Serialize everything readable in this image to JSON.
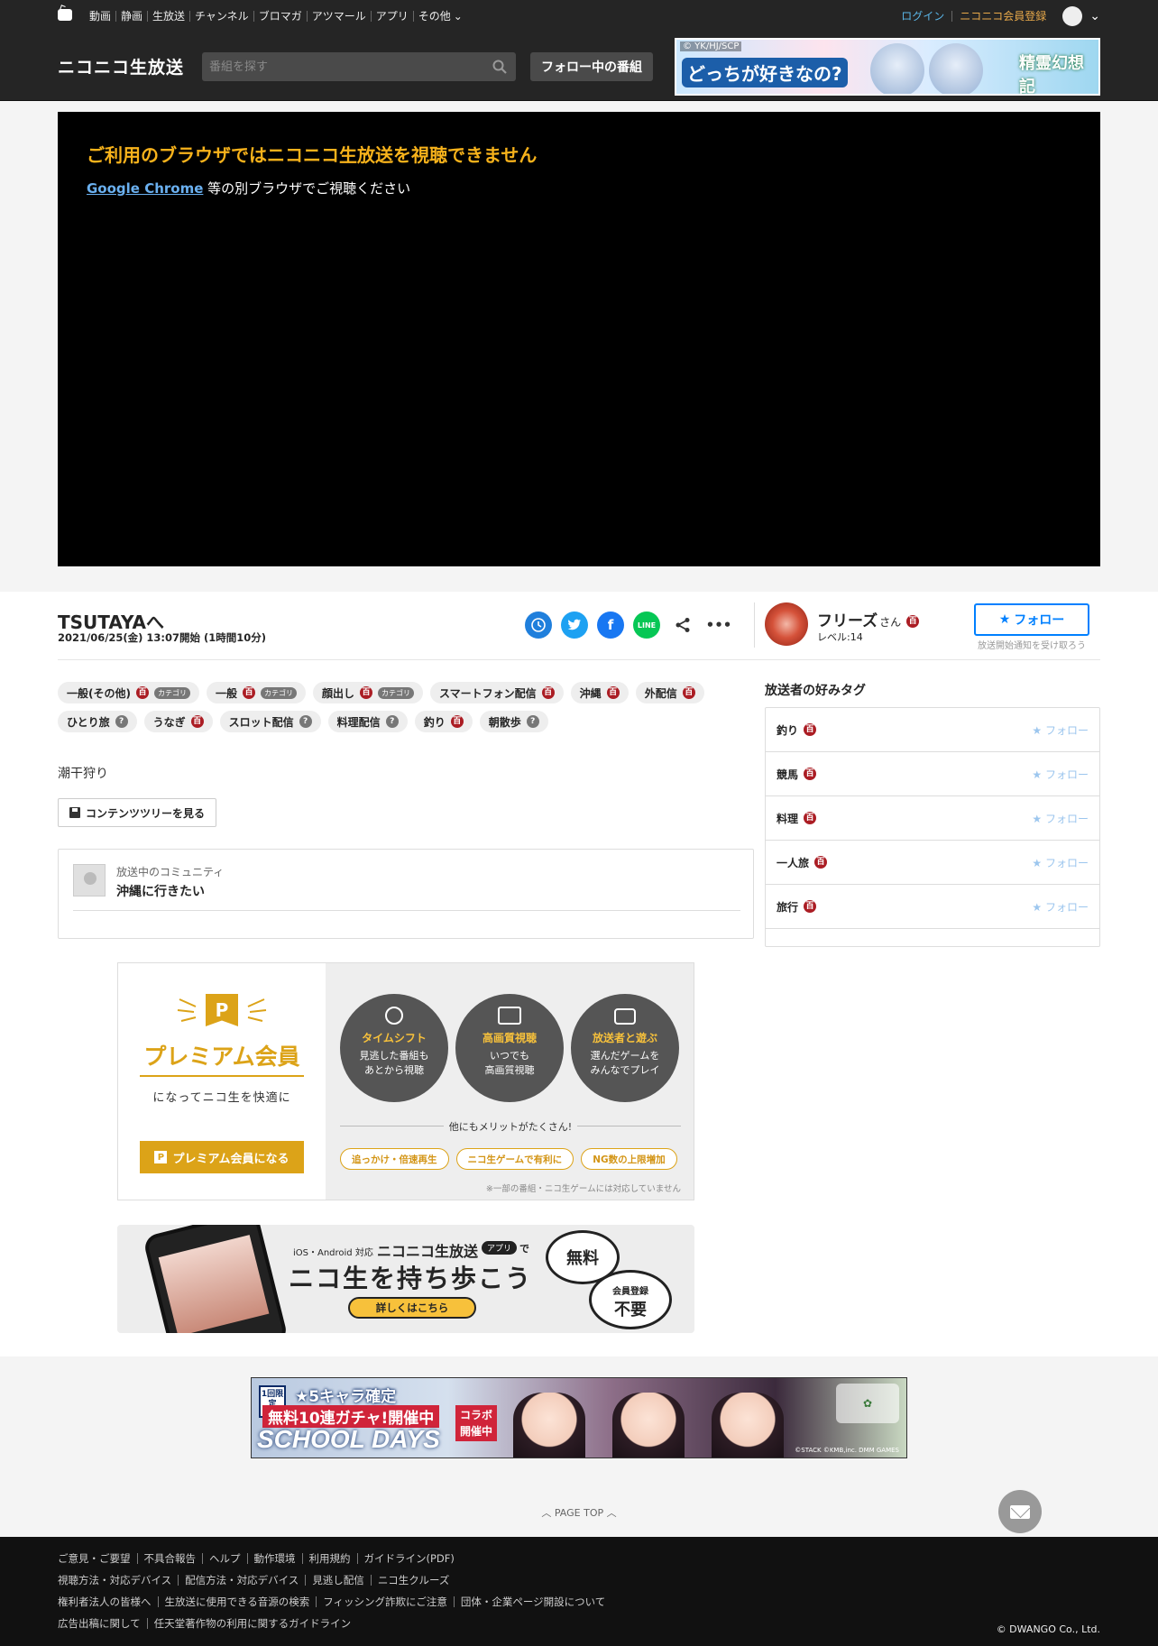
{
  "topnav": {
    "links": [
      "動画",
      "静画",
      "生放送",
      "チャンネル",
      "ブロマガ",
      "アツマール",
      "アプリ",
      "その他"
    ],
    "login": "ログイン",
    "register": "ニコニコ会員登録"
  },
  "header": {
    "logo": "ニコニコ生放送",
    "search_placeholder": "番組を探す",
    "follow_programs": "フォロー中の番組",
    "ad": {
      "copyright": "© YK/HJ/SCP",
      "text": "どっちが好きなの?",
      "title": "精霊幻想記"
    }
  },
  "player": {
    "error_title": "ご利用のブラウザではニコニコ生放送を視聴できません",
    "browser_link": "Google Chrome",
    "error_suffix": " 等の別ブラウザでご視聴ください"
  },
  "program": {
    "title": "TSUTAYAへ",
    "date": "2021/06/25(金) 13:07開始 (1時間10分)",
    "description": "潮干狩り",
    "content_tree": "コンテンツツリーを見る"
  },
  "caster": {
    "name": "フリーズ",
    "suffix": "さん",
    "level": "レベル:14",
    "follow": "フォロー",
    "follow_note": "放送開始通知を受け取ろう"
  },
  "tags": [
    [
      {
        "label": "一般(その他)",
        "badge": "百",
        "category": "カテゴリ"
      },
      {
        "label": "一般",
        "badge": "百",
        "category": "カテゴリ"
      },
      {
        "label": "顔出し",
        "badge": "百",
        "category": "カテゴリ"
      },
      {
        "label": "スマートフォン配信",
        "badge": "百",
        "category": ""
      },
      {
        "label": "沖縄",
        "badge": "百",
        "category": ""
      },
      {
        "label": "外配信",
        "badge": "百",
        "category": ""
      }
    ],
    [
      {
        "label": "ひとり旅",
        "badge": "?",
        "category": ""
      },
      {
        "label": "うなぎ",
        "badge": "百",
        "category": ""
      },
      {
        "label": "スロット配信",
        "badge": "?",
        "category": ""
      },
      {
        "label": "料理配信",
        "badge": "?",
        "category": ""
      },
      {
        "label": "釣り",
        "badge": "百",
        "category": ""
      },
      {
        "label": "朝散歩",
        "badge": "?",
        "category": ""
      }
    ]
  ],
  "community": {
    "label": "放送中のコミュニティ",
    "name": "沖縄に行きたい"
  },
  "favorite_tags": {
    "heading": "放送者の好みタグ",
    "follow_label": "フォロー",
    "items": [
      "釣り",
      "競馬",
      "料理",
      "一人旅",
      "旅行"
    ]
  },
  "premium": {
    "title": "プレミアム会員",
    "subtitle": "になってニコ生を快適に",
    "button": "プレミアム会員になる",
    "features": [
      {
        "title": "タイムシフト",
        "desc1": "見逃した番組も",
        "desc2": "あとから視聴"
      },
      {
        "title": "高画質視聴",
        "desc1": "いつでも",
        "desc2": "高画質視聴"
      },
      {
        "title": "放送者と遊ぶ",
        "desc1": "選んだゲームを",
        "desc2": "みんなでプレイ"
      }
    ],
    "merit": "他にもメリットがたくさん!",
    "pills": [
      "追っかけ・倍速再生",
      "ニコ生ゲームで有利に",
      "NG数の上限増加"
    ],
    "note": "※一部の番組・ニコ生ゲームには対応していません"
  },
  "app_banner": {
    "small": "iOS・Android 対応",
    "brand": "ニコニコ生放送",
    "app_tag": "アプリ",
    "de": "で",
    "headline": "ニコ生を持ち歩こう",
    "more": "詳しくはこちら",
    "free": "無料",
    "reg_small": "会員登録",
    "reg_big": "不要"
  },
  "bottom_ad": {
    "chip": "1回限定",
    "t1": "★5キャラ確定",
    "t2": "無料10連ガチャ!開催中",
    "t3": "SCHOOL DAYS",
    "t4": "コラボ開催中",
    "copyright": "©STACK ©KMB,inc. DMM GAMES"
  },
  "pagetop": "PAGE TOP",
  "footer": {
    "rows": [
      [
        "ご意見・ご要望",
        "不具合報告",
        "ヘルプ",
        "動作環境",
        "利用規約",
        "ガイドライン(PDF)"
      ],
      [
        "視聴方法・対応デバイス",
        "配信方法・対応デバイス",
        "見逃し配信",
        "ニコ生クルーズ"
      ],
      [
        "権利者法人の皆様へ",
        "生放送に使用できる音源の検索",
        "フィッシング詐欺にご注意",
        "団体・企業ページ開設について"
      ],
      [
        "広告出稿に関して",
        "任天堂著作物の利用に関するガイドライン"
      ]
    ],
    "copyright": "© DWANGO Co., Ltd."
  },
  "colors": {
    "header_bg": "#252525",
    "accent_gold": "#dca318",
    "follow_blue": "#0080ff",
    "error_yellow": "#f7b21b",
    "hyakka_red": "#ab1d24"
  }
}
